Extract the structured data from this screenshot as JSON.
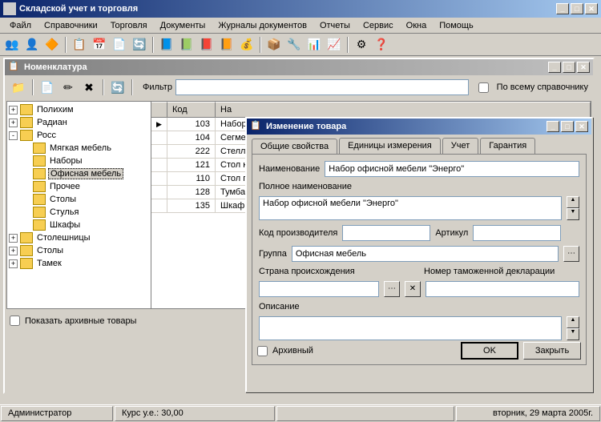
{
  "app": {
    "title": "Складской учет и торговля"
  },
  "menu": [
    "Файл",
    "Справочники",
    "Торговля",
    "Документы",
    "Журналы документов",
    "Отчеты",
    "Сервис",
    "Окна",
    "Помощь"
  ],
  "nomenclature": {
    "title": "Номенклатура",
    "filter_label": "Фильтр",
    "global_search_label": "По всему справочнику",
    "archive_label": "Показать архивные товары",
    "cols": {
      "code": "Код",
      "name": "На"
    },
    "tree": [
      {
        "label": "Полихим",
        "exp": "+",
        "indent": 0
      },
      {
        "label": "Радиан",
        "exp": "+",
        "indent": 0
      },
      {
        "label": "Росс",
        "exp": "-",
        "indent": 0
      },
      {
        "label": "Мягкая мебель",
        "exp": "",
        "indent": 1
      },
      {
        "label": "Наборы",
        "exp": "",
        "indent": 1
      },
      {
        "label": "Офисная мебель",
        "exp": "",
        "indent": 1,
        "selected": true
      },
      {
        "label": "Прочее",
        "exp": "",
        "indent": 1
      },
      {
        "label": "Столы",
        "exp": "",
        "indent": 1
      },
      {
        "label": "Стулья",
        "exp": "",
        "indent": 1
      },
      {
        "label": "Шкафы",
        "exp": "",
        "indent": 1
      },
      {
        "label": "Столешницы",
        "exp": "+",
        "indent": 0
      },
      {
        "label": "Столы",
        "exp": "+",
        "indent": 0
      },
      {
        "label": "Тамек",
        "exp": "+",
        "indent": 0
      }
    ],
    "rows": [
      {
        "code": "103",
        "name": "Набор",
        "current": true
      },
      {
        "code": "104",
        "name": "Сегме"
      },
      {
        "code": "222",
        "name": "Стелл"
      },
      {
        "code": "121",
        "name": "Стол к"
      },
      {
        "code": "110",
        "name": "Стол п"
      },
      {
        "code": "128",
        "name": "Тумба"
      },
      {
        "code": "135",
        "name": "Шкаф"
      }
    ]
  },
  "dialog": {
    "title": "Изменение товара",
    "tabs": [
      "Общие свойства",
      "Единицы измерения",
      "Учет",
      "Гарантия"
    ],
    "labels": {
      "name": "Наименование",
      "fullname": "Полное наименование",
      "manufcode": "Код производителя",
      "article": "Артикул",
      "group": "Группа",
      "country": "Страна происхождения",
      "customs": "Номер таможенной декларации",
      "description": "Описание",
      "archive": "Архивный",
      "ok": "OK",
      "close": "Закрыть"
    },
    "values": {
      "name": "Набор офисной мебели \"Энерго\"",
      "fullname": "Набор офисной мебели \"Энерго\"",
      "manufcode": "",
      "article": "",
      "group": "Офисная мебель",
      "country": "",
      "customs": "",
      "description": ""
    }
  },
  "status": {
    "user": "Администратор",
    "rate": "Курс у.е.: 30,00",
    "date": "вторник, 29 марта 2005г."
  }
}
